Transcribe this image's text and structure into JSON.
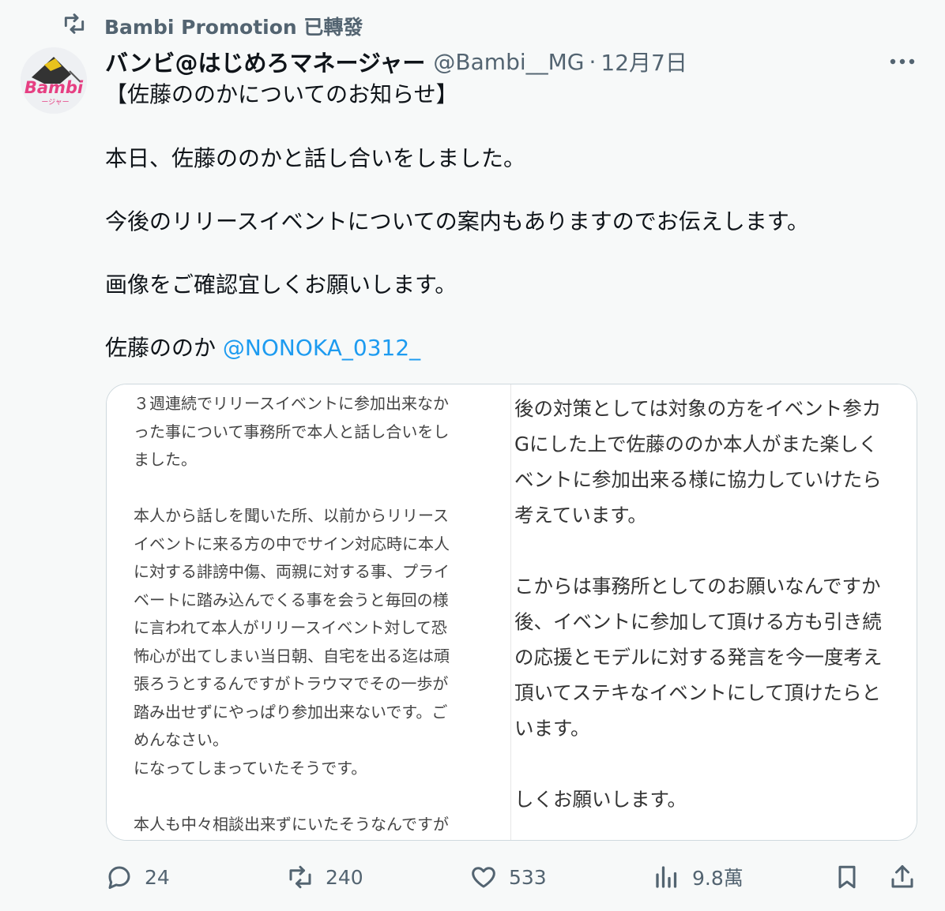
{
  "retweet_notice": {
    "text": "Bambi Promotion 已轉發"
  },
  "avatar": {
    "text": "Bambi",
    "subtext": "ージャー"
  },
  "tweet": {
    "display_name": "バンビ@はじめろマネージャー",
    "handle": "@Bambi__MG",
    "separator": "·",
    "timestamp": "12月7日",
    "lines": {
      "title": "【佐藤ののかについてのお知らせ】",
      "p1": "本日、佐藤ののかと話し合いをしました。",
      "p2": "今後のリリースイベントについての案内もありますのでお伝えします。",
      "p3": "画像をご確認宜しくお願いします。",
      "p4_prefix": "佐藤ののか ",
      "mention": "@NONOKA_0312_"
    }
  },
  "media": {
    "left_lines": [
      "３週連続でリリースイベントに参加出来なか",
      "った事について事務所で本人と話し合いをし",
      "ました。",
      "",
      "本人から話しを聞いた所、以前からリリース",
      "イベントに来る方の中でサイン対応時に本人",
      "に対する誹謗中傷、両親に対する事、プライ",
      "ベートに踏み込んでくる事を会うと毎回の様",
      "に言われて本人がリリースイベント対して恐",
      "怖心が出てしまい当日朝、自宅を出る迄は頑",
      "張ろうとするんですがトラウマでその一歩が",
      "踏み出せずにやっぱり参加出来ないです。ご",
      "めんなさい。",
      "になってしまっていたそうです。",
      "",
      "本人も中々相談出来ずにいたそうなんですが"
    ],
    "right_lines": [
      "後の対策としては対象の方をイベント参カ",
      "Gにした上で佐藤ののか本人がまた楽しく",
      "ベントに参加出来る様に協力していけたら",
      "考えています。",
      "",
      "こからは事務所としてのお願いなんですか",
      "後、イベントに参加して頂ける方も引き続",
      "の応援とモデルに対する発言を今一度考え",
      "頂いてステキなイベントにして頂けたらと",
      "います。",
      "",
      "しくお願いします。"
    ]
  },
  "actions": {
    "replies": "24",
    "retweets": "240",
    "likes": "533",
    "views": "9.8萬"
  },
  "colors": {
    "link": "#1d9bf0",
    "muted": "#536471",
    "background": "#f7f9f9"
  }
}
